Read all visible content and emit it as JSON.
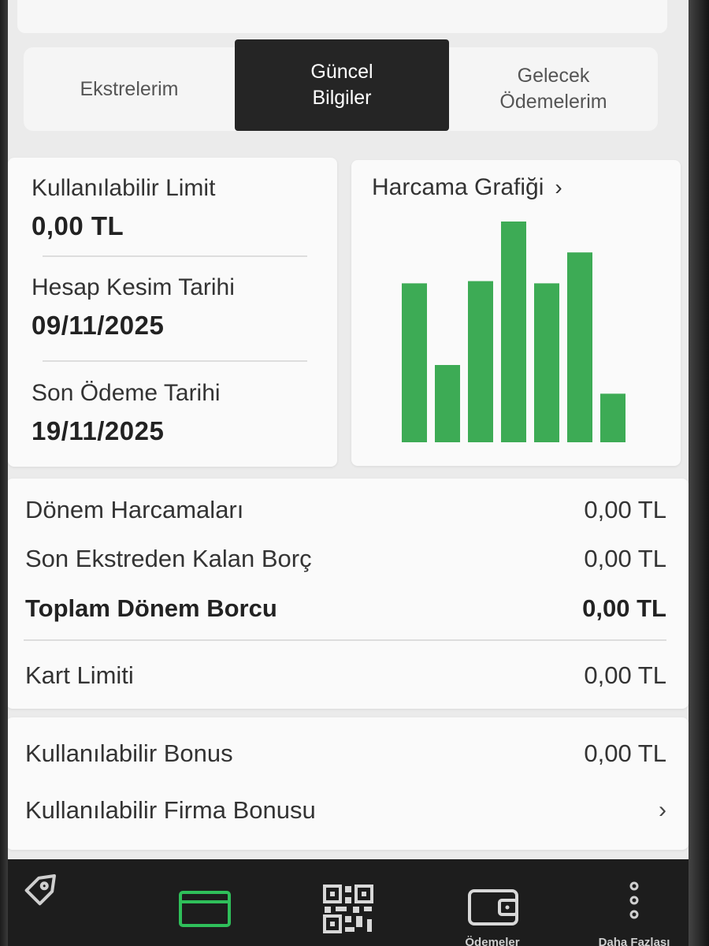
{
  "tabs": [
    {
      "label": "Ekstrelerim"
    },
    {
      "label_line1": "Güncel",
      "label_line2": "Bilgiler"
    },
    {
      "label_line1": "Gelecek",
      "label_line2": "Ödemelerim"
    }
  ],
  "info": {
    "available_limit_label": "Kullanılabilir Limit",
    "available_limit_value": "0,00 TL",
    "statement_date_label": "Hesap Kesim Tarihi",
    "statement_date_value": "09/11/2025",
    "due_date_label": "Son Ödeme Tarihi",
    "due_date_value": "19/11/2025"
  },
  "chart": {
    "title": "Harcama Grafiği",
    "chevron": "›"
  },
  "chart_data": {
    "type": "bar",
    "values": [
      0.72,
      0.35,
      0.73,
      1.0,
      0.72,
      0.86,
      0.22
    ],
    "color": "#3dab55",
    "title": "Harcama Grafiği",
    "ylim": [
      0,
      1
    ]
  },
  "summary": {
    "rows": [
      {
        "label": "Dönem Harcamaları",
        "value": "0,00 TL"
      },
      {
        "label": "Son Ekstreden Kalan Borç",
        "value": "0,00 TL"
      },
      {
        "label": "Toplam Dönem Borcu",
        "value": "0,00 TL"
      }
    ],
    "card_limit": {
      "label": "Kart Limiti",
      "value": "0,00 TL"
    }
  },
  "bonus": {
    "available_bonus_label": "Kullanılabilir Bonus",
    "available_bonus_value": "0,00 TL",
    "company_bonus_label": "Kullanılabilir Firma Bonusu",
    "chevron": "›"
  },
  "nav": {
    "payments_label": "Ödemeler",
    "more_label": "Daha Fazlası",
    "active_color": "#2fbf5a"
  },
  "colors": {
    "accent_green": "#3dab55",
    "active_tab_bg": "#252525",
    "nav_bg": "#1d1d1d"
  }
}
